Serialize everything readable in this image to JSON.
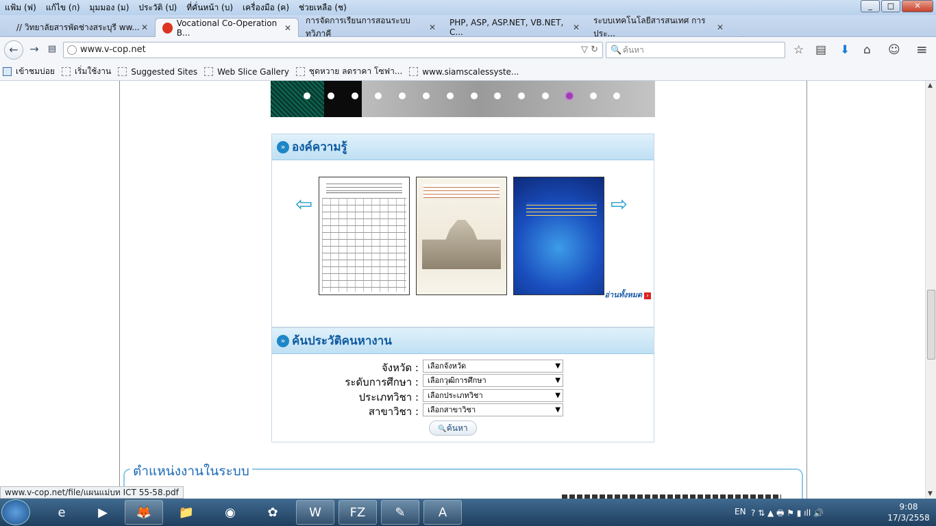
{
  "menu": [
    "แฟ้ม (ฟ)",
    "แก้ไข (ก)",
    "มุมมอง (ม)",
    "ประวัติ (ป)",
    "ที่คั่นหน้า (บ)",
    "เครื่องมือ (ค)",
    "ช่วยเหลือ (ช)"
  ],
  "window_controls": {
    "minimize": "_",
    "maximize": "□",
    "close": "✕"
  },
  "tabs": [
    {
      "label": "// วิทยาลัยสารพัดช่างสระบุรี ww...",
      "close": "✕"
    },
    {
      "label": "Vocational Co-Operation B...",
      "close": "✕"
    },
    {
      "label": "การจัดการเรียนการสอนระบบทวิภาคี",
      "close": "✕"
    },
    {
      "label": "PHP, ASP, ASP.NET, VB.NET, C...",
      "close": "✕"
    },
    {
      "label": "ระบบเทคโนโลยีสารสนเทศ การประ...",
      "close": "✕"
    }
  ],
  "new_tab": "+",
  "nav": {
    "back": "←",
    "forward": "→",
    "url": "www.v-cop.net",
    "url_controls": "▽ ↻",
    "search_placeholder": "ค้นหา",
    "search_icon": "🔍"
  },
  "toolbar_icons": {
    "bookmark": "☆",
    "library": "▤",
    "download": "⬇",
    "home": "⌂",
    "chat": "☺",
    "menu": "≡"
  },
  "bookmarks": [
    "เข้าชมบ่อย",
    "เริ่มใช้งาน",
    "Suggested Sites",
    "Web Slice Gallery",
    "ชุดหวาย ลดราคา โซฟา...",
    "www.siamscalessyste..."
  ],
  "slider": {
    "dot_count": 14,
    "active_dot": 11
  },
  "knowledge": {
    "title": "องค์ความรู้",
    "icon": "»",
    "prev": "⇦",
    "next": "⇨",
    "read_all": "อ่านทั้งหมด",
    "read_all_icon": "›"
  },
  "job_search": {
    "title": "ค้นประวัติคนหางาน",
    "fields": [
      {
        "label": "จังหวัด :",
        "value": "เลือกจังหวัด"
      },
      {
        "label": "ระดับการศึกษา :",
        "value": "เลือกวุฒิการศึกษา"
      },
      {
        "label": "ประเภทวิชา :",
        "value": "เลือกประเภทวิชา"
      },
      {
        "label": "สาขาวิชา :",
        "value": "เลือกสาขาวิชา"
      }
    ],
    "button": "ค้นหา",
    "button_icon": "🔍"
  },
  "jobs_section_title": "ตำแหน่งงานในระบบ",
  "status_url": "www.v-cop.net/file/แผนแม่บท ICT 55-58.pdf",
  "scroll": {
    "up": "▲",
    "down": "▼"
  },
  "taskbar": {
    "apps": [
      "e",
      "▶",
      "🦊",
      "📁",
      "◉",
      "✿",
      "W",
      "FZ",
      "✎",
      "A"
    ],
    "lang": "EN",
    "tray": "? ⇅ ▲ 🖶 ⚑ ▮ ıll 🔊",
    "time": "9:08",
    "date": "17/3/2558"
  }
}
